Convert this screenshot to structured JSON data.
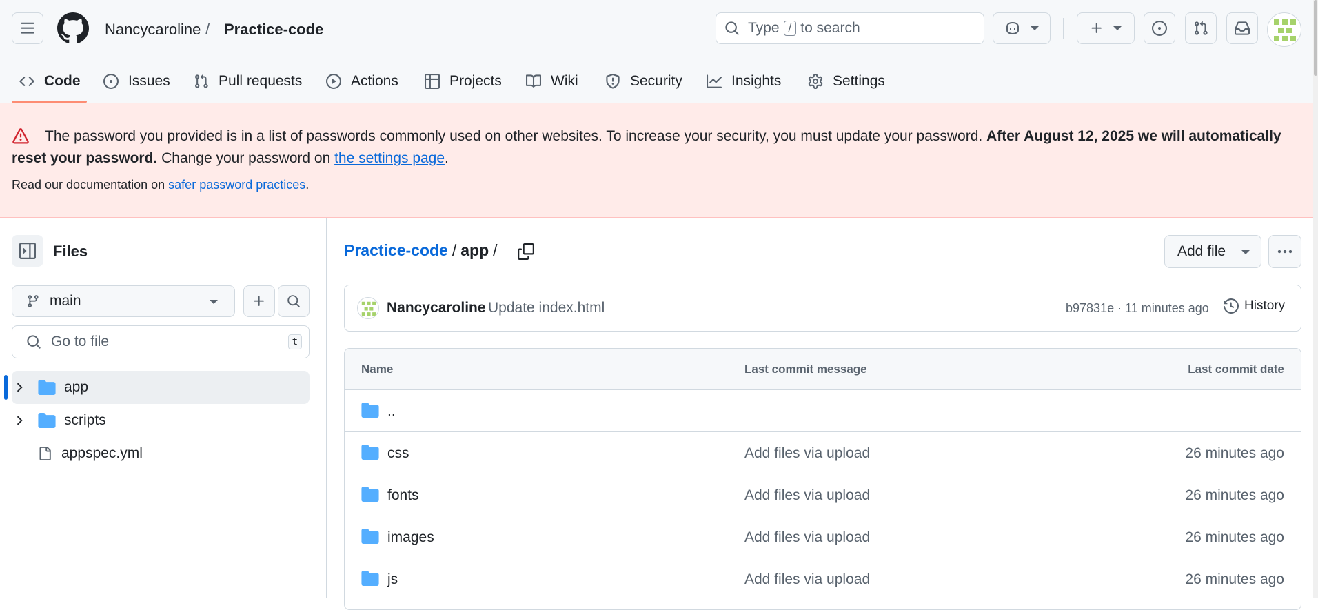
{
  "header": {
    "owner": "Nancycaroline",
    "separator": "/",
    "repo": "Practice-code",
    "search_prefix": "Type",
    "search_key": "/",
    "search_suffix": "to search"
  },
  "tabs": [
    {
      "label": "Code",
      "icon": "code-icon"
    },
    {
      "label": "Issues",
      "icon": "issue-icon"
    },
    {
      "label": "Pull requests",
      "icon": "pull-request-icon"
    },
    {
      "label": "Actions",
      "icon": "play-icon"
    },
    {
      "label": "Projects",
      "icon": "table-icon"
    },
    {
      "label": "Wiki",
      "icon": "book-icon"
    },
    {
      "label": "Security",
      "icon": "shield-icon"
    },
    {
      "label": "Insights",
      "icon": "graph-icon"
    },
    {
      "label": "Settings",
      "icon": "gear-icon"
    }
  ],
  "banner": {
    "text": "The password you provided is in a list of passwords commonly used on other websites. To increase your security, you must update your password.",
    "bold": "After August 12, 2025 we will automatically reset your password.",
    "change_prefix": "Change your password on",
    "change_link": "the settings page",
    "change_suffix": ".",
    "doc_prefix": "Read our documentation on",
    "doc_link": "safer password practices",
    "doc_suffix": "."
  },
  "sidebar": {
    "title": "Files",
    "branch": "main",
    "goto_placeholder": "Go to file",
    "goto_shortcut": "t",
    "tree": [
      {
        "label": "app",
        "type": "folder",
        "selected": true
      },
      {
        "label": "scripts",
        "type": "folder",
        "selected": false
      },
      {
        "label": "appspec.yml",
        "type": "file",
        "selected": false
      }
    ]
  },
  "main": {
    "crumb_repo": "Practice-code",
    "crumb_sep": "/",
    "crumb_current": "app",
    "crumb_trailing": "/",
    "add_file": "Add file",
    "commit": {
      "author": "Nancycaroline",
      "message": "Update index.html",
      "meta": "b97831e · 11 minutes ago",
      "history": "History"
    },
    "table": {
      "col_name": "Name",
      "col_message": "Last commit message",
      "col_date": "Last commit date",
      "rows": [
        {
          "name": "..",
          "message": "",
          "date": ""
        },
        {
          "name": "css",
          "message": "Add files via upload",
          "date": "26 minutes ago"
        },
        {
          "name": "fonts",
          "message": "Add files via upload",
          "date": "26 minutes ago"
        },
        {
          "name": "images",
          "message": "Add files via upload",
          "date": "26 minutes ago"
        },
        {
          "name": "js",
          "message": "Add files via upload",
          "date": "26 minutes ago"
        }
      ]
    }
  },
  "colors": {
    "accent": "#0969da",
    "banner_bg": "#ffebe9",
    "danger": "#d1242f",
    "folder": "#54aeff",
    "tab_underline": "#fd8c73"
  }
}
